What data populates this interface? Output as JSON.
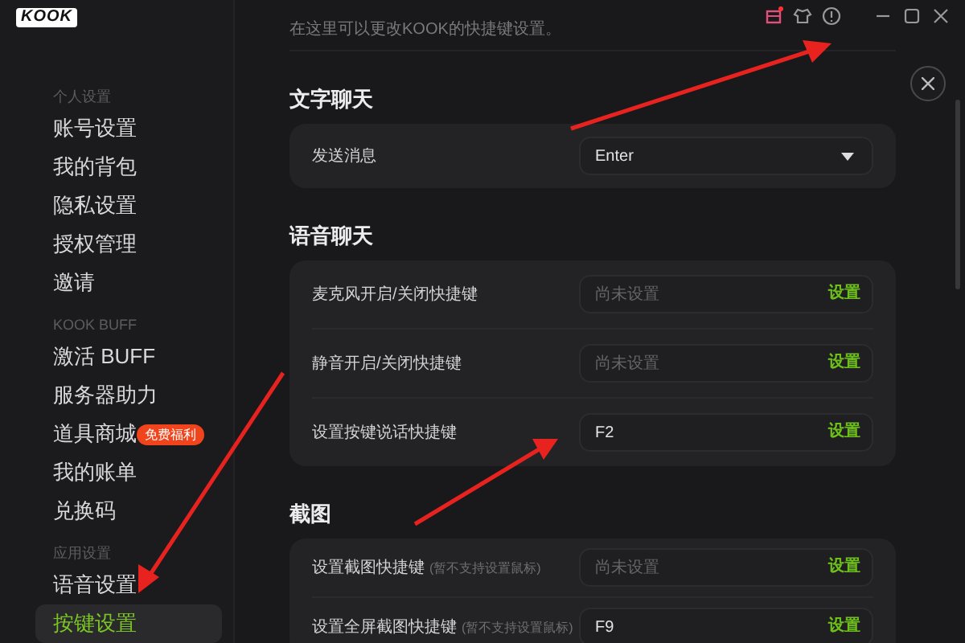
{
  "app": {
    "logo": "KOOK"
  },
  "sidebar": {
    "groups": [
      {
        "heading": "个人设置",
        "items": [
          {
            "label": "账号设置",
            "selected": false
          },
          {
            "label": "我的背包",
            "selected": false
          },
          {
            "label": "隐私设置",
            "selected": false
          },
          {
            "label": "授权管理",
            "selected": false
          },
          {
            "label": "邀请",
            "selected": false
          }
        ]
      },
      {
        "heading": "KOOK BUFF",
        "items": [
          {
            "label": "激活 BUFF",
            "selected": false
          },
          {
            "label": "服务器助力",
            "selected": false
          },
          {
            "label": "道具商城",
            "badge": "免费福利",
            "selected": false
          },
          {
            "label": "我的账单",
            "selected": false
          },
          {
            "label": "兑换码",
            "selected": false
          }
        ]
      },
      {
        "heading": "应用设置",
        "items": [
          {
            "label": "语音设置",
            "selected": false
          },
          {
            "label": "按键设置",
            "selected": true
          }
        ]
      }
    ]
  },
  "description": "在这里可以更改KOOK的快捷键设置。",
  "sections": [
    {
      "title": "文字聊天",
      "rows": [
        {
          "kind": "select",
          "label": "发送消息",
          "value": "Enter"
        }
      ]
    },
    {
      "title": "语音聊天",
      "rows": [
        {
          "kind": "hotkey",
          "label": "麦克风开启/关闭快捷键",
          "placeholder": "尚未设置",
          "action": "设置"
        },
        {
          "kind": "hotkey",
          "label": "静音开启/关闭快捷键",
          "placeholder": "尚未设置",
          "action": "设置"
        },
        {
          "kind": "hotkey",
          "label": "设置按键说话快捷键",
          "value": "F2",
          "action": "设置"
        }
      ]
    },
    {
      "title": "截图",
      "rows": [
        {
          "kind": "hotkey",
          "label": "设置截图快捷键",
          "note": "(暂不支持设置鼠标)",
          "placeholder": "尚未设置",
          "action": "设置"
        },
        {
          "kind": "hotkey",
          "label": "设置全屏截图快捷键",
          "note": "(暂不支持设置鼠标)",
          "value": "F9",
          "action": "设置"
        }
      ]
    }
  ]
}
